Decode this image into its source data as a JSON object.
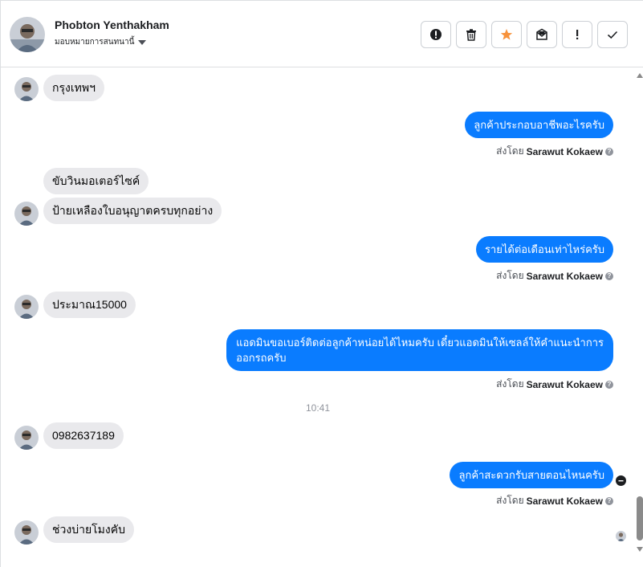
{
  "header": {
    "name": "Phobton Yenthakham",
    "assign_label": "มอบหมายการสนทนานี้"
  },
  "actions": [
    {
      "name": "spam-button",
      "icon": "alert-circle-icon"
    },
    {
      "name": "delete-button",
      "icon": "trash-icon"
    },
    {
      "name": "star-button",
      "icon": "star-icon",
      "color": "#f7923b"
    },
    {
      "name": "unread-button",
      "icon": "mail-icon"
    },
    {
      "name": "follow-up-button",
      "icon": "exclamation-icon"
    },
    {
      "name": "done-button",
      "icon": "check-icon"
    }
  ],
  "messages": {
    "m1": "กรุงเทพฯ",
    "m2": "ลูกค้าประกอบอาชีพอะไรครับ",
    "m3": "ขับวินมอเตอร์ไซค์",
    "m4": "ป้ายเหลืองใบอนุญาตครบทุกอย่าง",
    "m5": "รายได้ต่อเดือนเท่าไหร่ครับ",
    "m6": "ประมาณ15000",
    "m7_line1": "แอดมินขอเบอร์ติดต่อลูกค้าหน่อยได้ไหมครับ เดี๋ยวแอดมินให้เซลล์ให้คำแนะนำการ",
    "m7_line2": "ออกรถครับ",
    "time": "10:41",
    "m8": "0982637189",
    "m9": "ลูกค้าสะดวกรับสายตอนไหนครับ",
    "m10": "ช่วงบ่ายโมงคับ"
  },
  "sent_by": {
    "prefix": "ส่งโดย",
    "agent": "Sarawut Kokaew"
  },
  "colors": {
    "outgoing": "#0a7cff",
    "incoming": "#e9e9ec",
    "star": "#f7923b"
  }
}
